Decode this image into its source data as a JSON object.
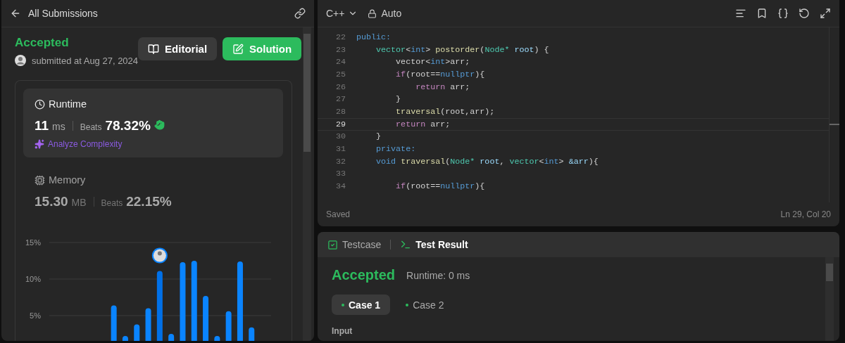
{
  "submission": {
    "back_label": "All Submissions",
    "status": "Accepted",
    "submitted": "submitted at Aug 27, 2024",
    "buttons": [
      {
        "label": "Editorial",
        "kind": "plain"
      },
      {
        "label": "Solution",
        "kind": "primary"
      }
    ],
    "runtime": {
      "title": "Runtime",
      "value": "11",
      "unit": "ms",
      "beats_label": "Beats",
      "beats": "78.32%",
      "analyze": "Analyze Complexity"
    },
    "memory": {
      "title": "Memory",
      "value": "15.30",
      "unit": "MB",
      "beats_label": "Beats",
      "beats": "22.15%"
    },
    "chart_data": {
      "type": "bar",
      "ylim": [
        0,
        15
      ],
      "yticks": [
        {
          "value": 5,
          "label": "5%"
        },
        {
          "value": 10,
          "label": "10%"
        },
        {
          "value": 15,
          "label": "15%"
        }
      ],
      "values": [
        null,
        null,
        null,
        null,
        null,
        6.4,
        2.2,
        3.8,
        6.0,
        11.1,
        2.5,
        12.3,
        12.5,
        7.7,
        2.2,
        5.6,
        12.4,
        3.4,
        null
      ],
      "grid": true
    },
    "chart_bars": [
      {
        "selected": false
      },
      {
        "selected": false
      },
      {
        "selected": false
      },
      {
        "selected": false
      },
      {
        "selected": true
      },
      {
        "selected": false
      },
      {
        "selected": false
      },
      {
        "selected": false
      },
      {
        "selected": false
      },
      {
        "selected": false
      },
      {
        "selected": false
      },
      {
        "selected": false
      },
      {
        "selected": false
      }
    ]
  },
  "editor": {
    "language": "C++",
    "mode": "Auto",
    "status": "Saved",
    "cursor": "Ln 29, Col 20",
    "lines": [
      {
        "number": "22",
        "current": false,
        "tokens": [
          {
            "t": "public:",
            "kind": "storage"
          }
        ]
      },
      {
        "number": "23",
        "current": false,
        "tokens": [
          {
            "t": "    vector",
            "kind": "type"
          },
          {
            "t": "<",
            "kind": "plain"
          },
          {
            "t": "int",
            "kind": "storage"
          },
          {
            "t": "> ",
            "kind": "plain"
          },
          {
            "t": "postorder",
            "kind": "function"
          },
          {
            "t": "(",
            "kind": "plain"
          },
          {
            "t": "Node* ",
            "kind": "type"
          },
          {
            "t": "root",
            "kind": "param"
          },
          {
            "t": ") {",
            "kind": "plain"
          }
        ]
      },
      {
        "number": "24",
        "current": false,
        "tokens": [
          {
            "t": "        vector<",
            "kind": "plain"
          },
          {
            "t": "int",
            "kind": "storage"
          },
          {
            "t": ">arr;",
            "kind": "plain"
          }
        ]
      },
      {
        "number": "25",
        "current": false,
        "tokens": [
          {
            "t": "        if",
            "kind": "control"
          },
          {
            "t": "(root==",
            "kind": "plain"
          },
          {
            "t": "nullptr",
            "kind": "storage"
          },
          {
            "t": "){",
            "kind": "plain"
          }
        ]
      },
      {
        "number": "26",
        "current": false,
        "tokens": [
          {
            "t": "            return",
            "kind": "control"
          },
          {
            "t": " arr;",
            "kind": "plain"
          }
        ]
      },
      {
        "number": "27",
        "current": false,
        "tokens": [
          {
            "t": "        }",
            "kind": "plain"
          }
        ]
      },
      {
        "number": "28",
        "current": false,
        "tokens": [
          {
            "t": "        traversal",
            "kind": "function"
          },
          {
            "t": "(root,arr);",
            "kind": "plain"
          }
        ]
      },
      {
        "number": "29",
        "current": true,
        "tokens": [
          {
            "t": "        return",
            "kind": "control"
          },
          {
            "t": " arr;",
            "kind": "plain"
          }
        ]
      },
      {
        "number": "30",
        "current": false,
        "tokens": [
          {
            "t": "    }",
            "kind": "plain"
          }
        ]
      },
      {
        "number": "31",
        "current": false,
        "tokens": [
          {
            "t": "    private:",
            "kind": "storage"
          }
        ]
      },
      {
        "number": "32",
        "current": false,
        "tokens": [
          {
            "t": "    void ",
            "kind": "storage"
          },
          {
            "t": "traversal",
            "kind": "function"
          },
          {
            "t": "(",
            "kind": "plain"
          },
          {
            "t": "Node* ",
            "kind": "type"
          },
          {
            "t": "root",
            "kind": "param"
          },
          {
            "t": ", ",
            "kind": "plain"
          },
          {
            "t": "vector",
            "kind": "type"
          },
          {
            "t": "<",
            "kind": "plain"
          },
          {
            "t": "int",
            "kind": "storage"
          },
          {
            "t": "> ",
            "kind": "plain"
          },
          {
            "t": "&arr",
            "kind": "param"
          },
          {
            "t": "){",
            "kind": "plain"
          }
        ]
      },
      {
        "number": "33",
        "current": false
      },
      {
        "number": "34",
        "current": false,
        "tokens": [
          {
            "t": "        if",
            "kind": "control"
          },
          {
            "t": "(root==",
            "kind": "plain"
          },
          {
            "t": "nullptr",
            "kind": "storage"
          },
          {
            "t": "){",
            "kind": "plain"
          }
        ]
      }
    ]
  },
  "console": {
    "tabs": [
      {
        "label": "Testcase",
        "kind": "testcase",
        "selected": false
      },
      {
        "label": "Test Result",
        "kind": "result",
        "selected": true
      }
    ],
    "status": "Accepted",
    "runtime": "Runtime: 0 ms",
    "cases": [
      {
        "label": "Case 1",
        "selected": true
      },
      {
        "label": "Case 2",
        "selected": false
      }
    ],
    "input_label": "Input"
  }
}
